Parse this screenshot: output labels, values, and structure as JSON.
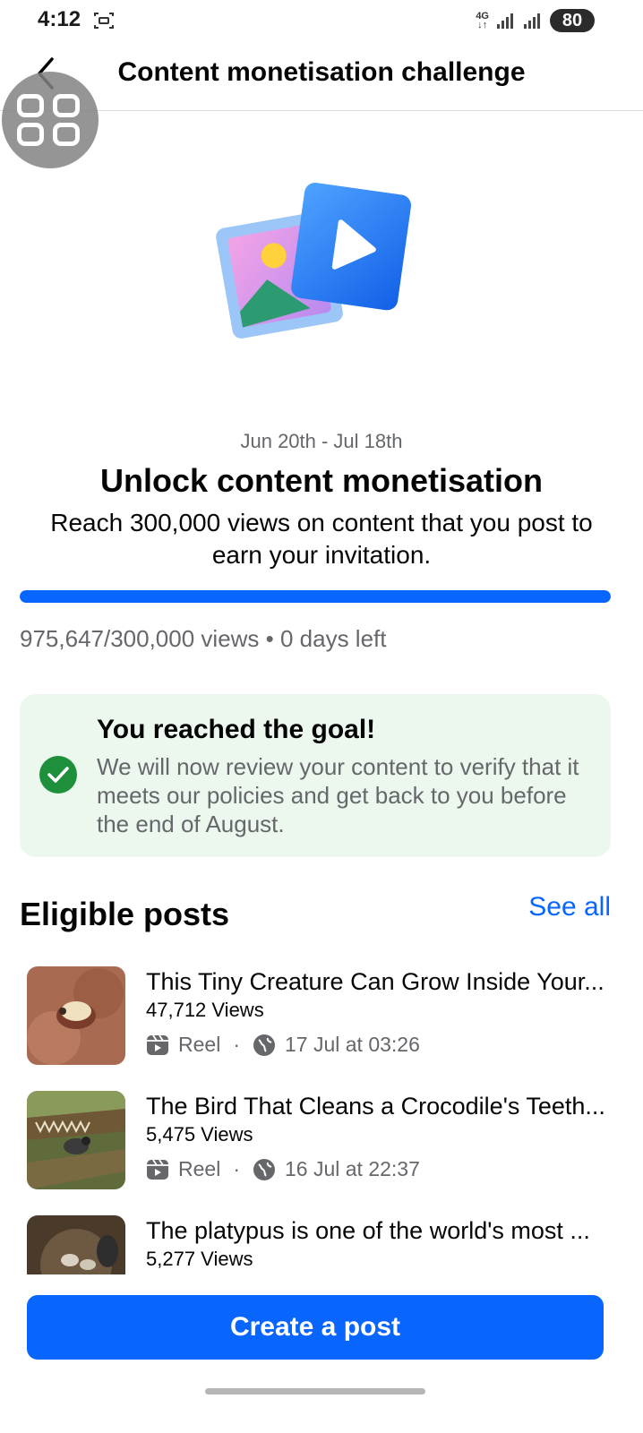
{
  "status_bar": {
    "time": "4:12",
    "network": "4G",
    "battery": "80",
    "icons": [
      "screen-record-icon",
      "signal-icon",
      "signal-icon",
      "battery-icon"
    ]
  },
  "header": {
    "title": "Content monetisation challenge",
    "back_icon": "back-arrow-icon"
  },
  "challenge": {
    "date_range": "Jun 20th - Jul 18th",
    "headline": "Unlock content monetisation",
    "subtext": "Reach 300,000 views on content that you post to earn your invitation.",
    "progress_fraction": 1.0,
    "progress_text": "975,647/300,000 views • 0 days left"
  },
  "goal_card": {
    "title": "You reached the goal!",
    "text": "We will now review your content to verify that it meets our policies and get back to you before the end of August.",
    "icon": "check-circle-icon"
  },
  "eligible_posts": {
    "title": "Eligible posts",
    "see_all": "See all",
    "items": [
      {
        "title": "This Tiny Creature Can Grow Inside Your...",
        "views": "47,712 Views",
        "type": "Reel",
        "dot": "·",
        "date": "17 Jul at 03:26"
      },
      {
        "title": "The Bird That Cleans a Crocodile's Teeth...",
        "views": "5,475 Views",
        "type": "Reel",
        "dot": "·",
        "date": "16 Jul at 22:37"
      },
      {
        "title": "The platypus is one of the world's most ...",
        "views": "5,277 Views"
      }
    ]
  },
  "create_button": "Create a post",
  "colors": {
    "accent": "#0866ff",
    "success": "#1e8f3b",
    "card_bg": "#ecf8ee",
    "secondary_text": "#65676b"
  }
}
